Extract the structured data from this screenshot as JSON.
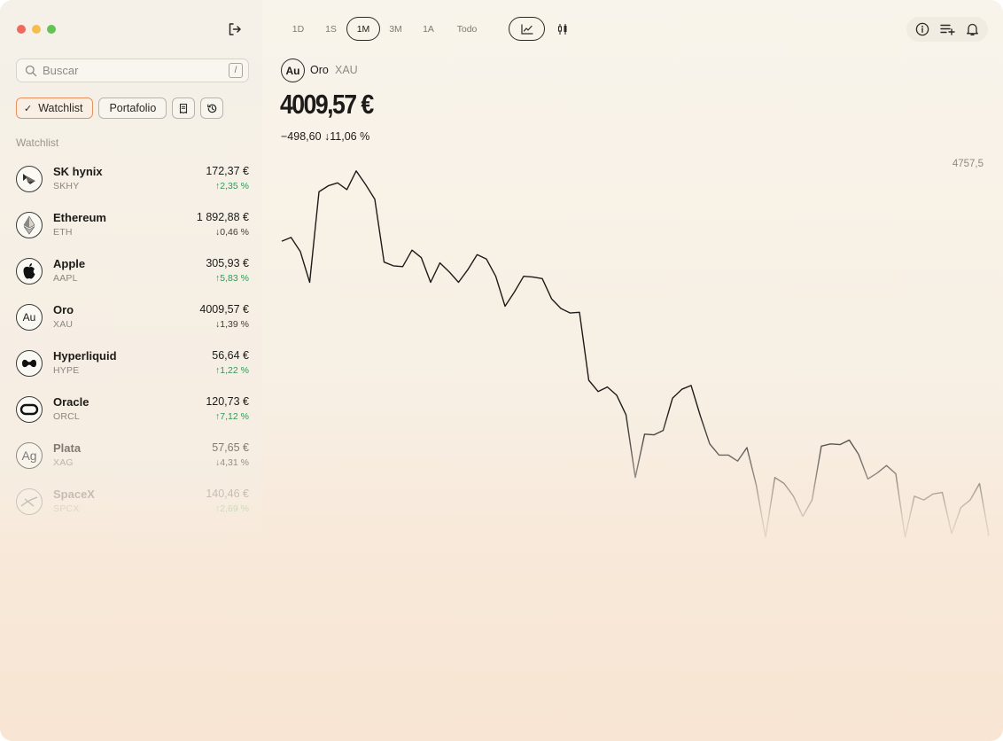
{
  "app": {
    "logout_icon": "logout-icon"
  },
  "search": {
    "placeholder": "Buscar",
    "shortcut": "/"
  },
  "filters": {
    "watchlist": "Watchlist",
    "portfolio": "Portafolio"
  },
  "section_title": "Watchlist",
  "watchlist": [
    {
      "name": "SK hynix",
      "ticker": "SKHY",
      "price": "172,37 €",
      "change": "↑2,35 %",
      "direction": "up",
      "logo": "sk-hynix-logo"
    },
    {
      "name": "Ethereum",
      "ticker": "ETH",
      "price": "1 892,88 €",
      "change": "↓0,46 %",
      "direction": "down",
      "logo": "ethereum-logo"
    },
    {
      "name": "Apple",
      "ticker": "AAPL",
      "price": "305,93 €",
      "change": "↑5,83 %",
      "direction": "up",
      "logo": "apple-logo"
    },
    {
      "name": "Oro",
      "ticker": "XAU",
      "price": "4009,57 €",
      "change": "↓1,39 %",
      "direction": "down",
      "logo_text": "Au"
    },
    {
      "name": "Hyperliquid",
      "ticker": "HYPE",
      "price": "56,64 €",
      "change": "↑1,22 %",
      "direction": "up",
      "logo": "hyperliquid-logo"
    },
    {
      "name": "Oracle",
      "ticker": "ORCL",
      "price": "120,73 €",
      "change": "↑7,12 %",
      "direction": "up",
      "logo": "oracle-logo"
    },
    {
      "name": "Plata",
      "ticker": "XAG",
      "price": "57,65 €",
      "change": "↓4,31 %",
      "direction": "down",
      "logo_text": "Ag"
    },
    {
      "name": "SpaceX",
      "ticker": "SPCX",
      "price": "140,46 €",
      "change": "↑2,69 %",
      "direction": "up",
      "logo": "spacex-logo"
    }
  ],
  "ranges": [
    "1D",
    "1S",
    "1M",
    "3M",
    "1A",
    "Todo"
  ],
  "active_range": "1M",
  "chart_types": [
    "line-chart-icon",
    "candlestick-icon"
  ],
  "toolbar_icons": [
    "info-icon",
    "add-to-list-icon",
    "bell-icon"
  ],
  "asset": {
    "badge": "Au",
    "name": "Oro",
    "ticker": "XAU",
    "price": "4009,57 €",
    "delta": "−498,60 ↓11,06 %",
    "y_max_label": "4757,5"
  },
  "chart_data": {
    "type": "line",
    "series": [
      {
        "values": [
          4646,
          4651,
          4632,
          4591,
          4712,
          4720,
          4724,
          4715,
          4740,
          4722,
          4702,
          4618,
          4613,
          4612,
          4634,
          4624,
          4591,
          4617,
          4605,
          4591,
          4608,
          4628,
          4622,
          4599,
          4559,
          4578,
          4599,
          4598,
          4596,
          4569,
          4556,
          4550,
          4551,
          4460,
          4445,
          4451,
          4440,
          4414,
          4330,
          4388,
          4387,
          4393,
          4436,
          4448,
          4453,
          4412,
          4375,
          4360,
          4360,
          4352,
          4370,
          4320,
          4250,
          4330,
          4322,
          4305,
          4278,
          4300,
          4372,
          4375,
          4374,
          4380,
          4361,
          4328,
          4336,
          4346,
          4335,
          4250,
          4305,
          4300,
          4308,
          4310,
          4255,
          4290,
          4300,
          4322,
          4252
        ]
      }
    ],
    "y_max": 4757.5,
    "grid": false
  }
}
